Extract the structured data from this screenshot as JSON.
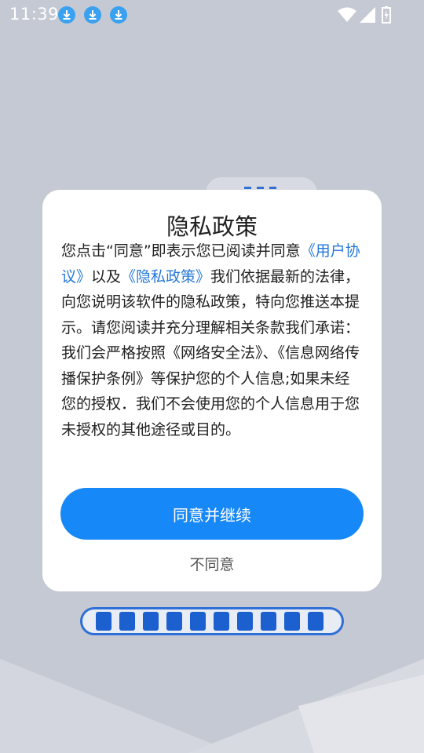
{
  "status_bar": {
    "time": "11:39",
    "notification_icons": [
      "download-icon",
      "download-icon",
      "download-icon"
    ],
    "right_icons": [
      "wifi-icon",
      "signal-icon",
      "battery-charging-icon"
    ]
  },
  "dialog": {
    "title": "隐私政策",
    "body": {
      "p1_prefix": "您点击“同意”即表示您已阅读并同意",
      "user_agreement_link": "《用户协议》",
      "p1_mid": "以及",
      "privacy_policy_link": "《隐私政策》",
      "p1_suffix": "我们依据最新的法律，向您说明该软件的隐私政策，特向您推送本提示。请您阅读并充分理解相关条款我们承诺：",
      "p2": "我们会严格按照《网络安全法》、《信息网络传播保护条例》等保护您的个人信息;如果未经您的授权．我们不会使用您的个人信息用于您未授权的其他途径或目的。"
    },
    "agree_label": "同意并继续",
    "decline_label": "不同意"
  },
  "colors": {
    "accent": "#1788f7",
    "link": "#2678d9",
    "background": "#c5c9d3",
    "loading_stripe": "#1c5fcf"
  }
}
